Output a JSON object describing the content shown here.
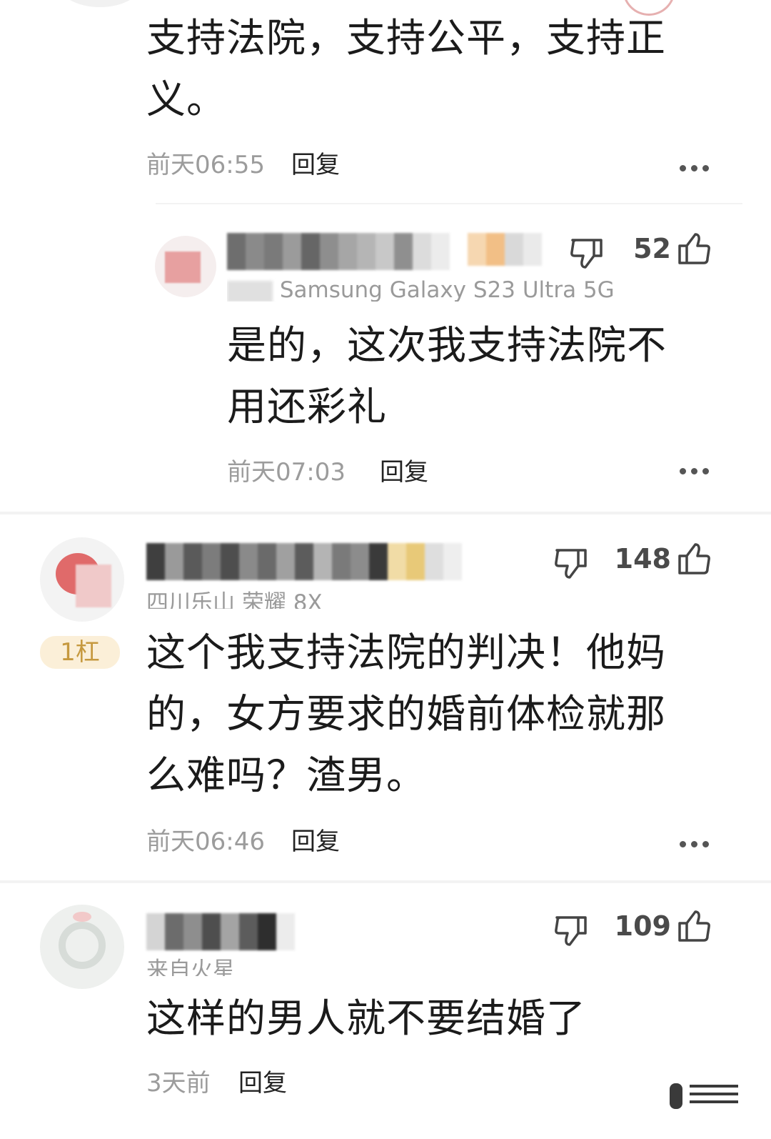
{
  "comments": [
    {
      "text": "支持法院，支持公平，支持正义。",
      "time": "前天06:55",
      "reply_label": "回复"
    },
    {
      "device": "Samsung Galaxy S23 Ultra 5G",
      "likes": "52",
      "text": "是的，这次我支持法院不用还彩礼",
      "time": "前天07:03",
      "reply_label": "回复"
    },
    {
      "device": "四川乐山 荣耀 8X",
      "likes": "148",
      "badge": "1杠",
      "text": "这个我支持法院的判决！他妈的，女方要求的婚前体检就那么难吗？渣男。",
      "time": "前天06:46",
      "reply_label": "回复"
    },
    {
      "device": "来自火星",
      "likes": "109",
      "text": "这样的男人就不要结婚了",
      "time": "3天前",
      "reply_label": "回复"
    }
  ],
  "colors": {
    "time": "#9c9c9c",
    "badge_bg": "#fbefd8",
    "badge_text": "#c6993f",
    "avatar_red": "#e06a6a"
  },
  "icons": [
    "dislike-icon",
    "like-icon",
    "more-icon"
  ]
}
